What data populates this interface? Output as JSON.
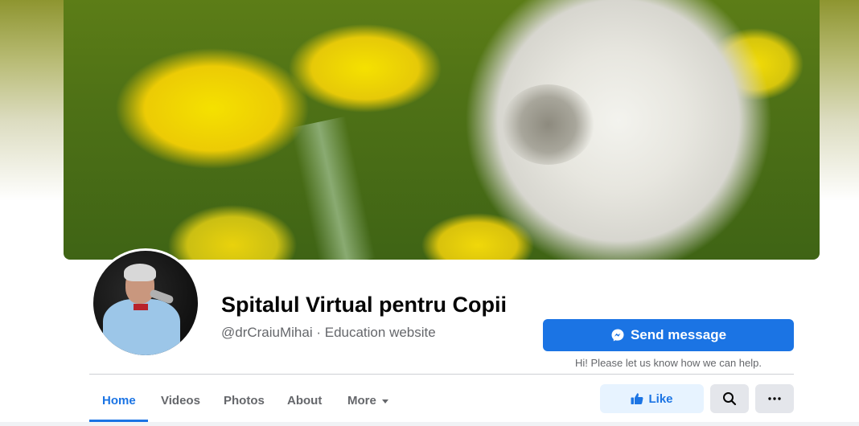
{
  "page": {
    "title": "Spitalul Virtual pentru Copii",
    "handle_category": "@drCraiuMihai · Education website"
  },
  "actions": {
    "send_message_label": "Send message",
    "help_text": "Hi! Please let us know how we can help.",
    "like_label": "Like"
  },
  "nav": {
    "tabs": [
      {
        "label": "Home",
        "active": true
      },
      {
        "label": "Videos"
      },
      {
        "label": "Photos"
      },
      {
        "label": "About"
      },
      {
        "label": "More"
      }
    ]
  },
  "icons": {
    "messenger": "messenger-icon",
    "like": "thumbs-up-icon",
    "search": "search-icon",
    "more": "ellipsis-icon",
    "dropdown": "caret-down-icon"
  },
  "colors": {
    "accent": "#1b74e4",
    "accent_light": "#e7f3ff",
    "secondary_button": "#e4e6eb",
    "text_primary": "#050505",
    "text_secondary": "#65676b"
  }
}
